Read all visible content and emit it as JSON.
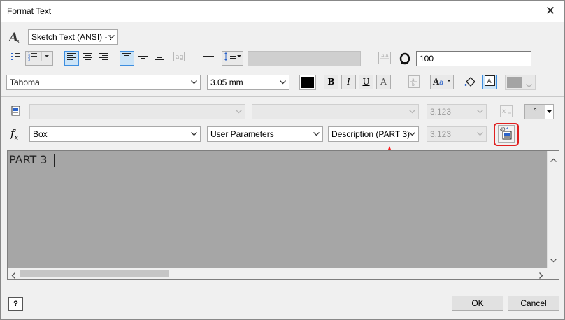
{
  "window": {
    "title": "Format Text",
    "close_glyph": "✕"
  },
  "row1": {
    "style_icon": "text-style-icon",
    "style_select": "Sketch Text (ANSI) - :",
    "rotation_value": "100"
  },
  "row2": {
    "font": "Tahoma",
    "size": "3.05 mm",
    "bold": "B",
    "italic": "I",
    "underline": "U",
    "strike": "A",
    "text_color": "#000000"
  },
  "row3": {
    "disabled_value": "3.123",
    "symbol": "°"
  },
  "row4": {
    "fx_label": "fx",
    "component": "Box",
    "param_type": "User Parameters",
    "parameter": "Description (PART 3)",
    "precision": "3.123"
  },
  "editor": {
    "text": "PART 3",
    "background": "#a6a6a6"
  },
  "footer": {
    "ok": "OK",
    "cancel": "Cancel",
    "help_glyph": "?"
  },
  "colors": {
    "accent": "#3d8ee0",
    "highlight": "#e02020",
    "arrow": "#ff1a1a"
  }
}
